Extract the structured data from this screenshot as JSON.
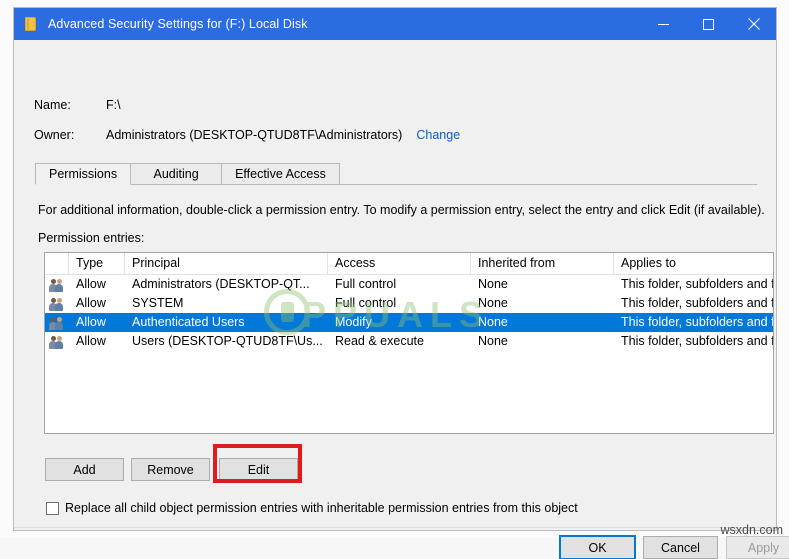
{
  "window": {
    "title": "Advanced Security Settings for (F:) Local Disk",
    "icon": "folder-icon",
    "title_bar_color": "#2b6de0",
    "controls": {
      "minimize": "minimize-icon",
      "maximize": "maximize-icon",
      "close": "close-icon"
    }
  },
  "header": {
    "name_label": "Name:",
    "name_value": "F:\\",
    "owner_label": "Owner:",
    "owner_value": "Administrators (DESKTOP-QTUD8TF\\Administrators)",
    "change_link": "Change",
    "link_color": "#0b5fc4"
  },
  "tabs": [
    {
      "label": "Permissions",
      "active": true
    },
    {
      "label": "Auditing",
      "active": false
    },
    {
      "label": "Effective Access",
      "active": false
    }
  ],
  "main": {
    "info_text": "For additional information, double-click a permission entry. To modify a permission entry, select the entry and click Edit (if available).",
    "entries_label": "Permission entries:"
  },
  "table": {
    "columns": [
      "",
      "Type",
      "Principal",
      "Access",
      "Inherited from",
      "Applies to"
    ],
    "selection_color": "#0078d7",
    "rows": [
      {
        "icon": "users-icon",
        "type": "Allow",
        "principal": "Administrators (DESKTOP-QT...",
        "access": "Full control",
        "inherited_from": "None",
        "applies_to": "This folder, subfolders and files",
        "selected": false
      },
      {
        "icon": "users-icon",
        "type": "Allow",
        "principal": "SYSTEM",
        "access": "Full control",
        "inherited_from": "None",
        "applies_to": "This folder, subfolders and files",
        "selected": false
      },
      {
        "icon": "users-icon",
        "type": "Allow",
        "principal": "Authenticated Users",
        "access": "Modify",
        "inherited_from": "None",
        "applies_to": "This folder, subfolders and files",
        "selected": true
      },
      {
        "icon": "users-icon",
        "type": "Allow",
        "principal": "Users (DESKTOP-QTUD8TF\\Us...",
        "access": "Read & execute",
        "inherited_from": "None",
        "applies_to": "This folder, subfolders and files",
        "selected": false
      }
    ]
  },
  "actions": {
    "add": "Add",
    "remove": "Remove",
    "edit": "Edit",
    "edit_highlight_color": "#e01b1b"
  },
  "checkbox": {
    "label": "Replace all child object permission entries with inheritable permission entries from this object",
    "checked": false
  },
  "footer": {
    "ok": "OK",
    "cancel": "Cancel",
    "apply": "Apply",
    "apply_disabled": true
  },
  "watermarks": {
    "overlay_text": "PPUALS",
    "overlay_color": "#8fbf70",
    "corner_text": "wsxdn.com"
  }
}
